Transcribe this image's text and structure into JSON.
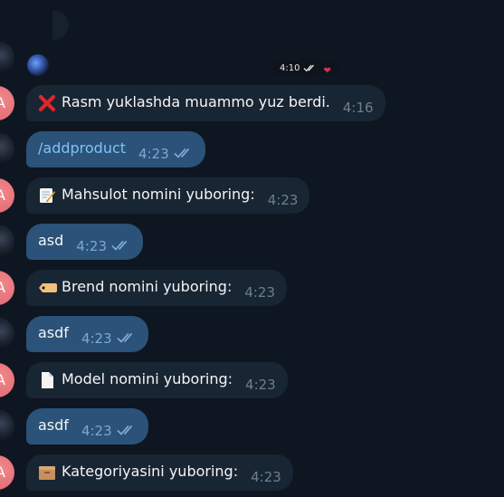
{
  "top": {
    "sticker_time": "4:10",
    "reaction_icon": "heart-icon"
  },
  "avatars": {
    "bot_letter": "A"
  },
  "messages": [
    {
      "side": "in",
      "emoji": "cross-mark-icon",
      "text": "Rasm yuklashda muammo yuz berdi.",
      "time": "4:16"
    },
    {
      "side": "out",
      "text": "/addproduct",
      "time": "4:23",
      "read": true
    },
    {
      "side": "in",
      "emoji": "memo-icon",
      "text": "Mahsulot nomini yuboring:",
      "time": "4:23"
    },
    {
      "side": "out",
      "text": "asd",
      "time": "4:23",
      "read": true
    },
    {
      "side": "in",
      "emoji": "label-tag-icon",
      "text": "Brend nomini yuboring:",
      "time": "4:23"
    },
    {
      "side": "out",
      "text": "asdf",
      "time": "4:23",
      "read": true
    },
    {
      "side": "in",
      "emoji": "page-icon",
      "text": "Model nomini yuboring:",
      "time": "4:23"
    },
    {
      "side": "out",
      "text": "asdf",
      "time": "4:23",
      "read": true
    },
    {
      "side": "in",
      "emoji": "file-box-icon",
      "text": "Kategoriyasini yuboring:",
      "time": "4:23"
    }
  ],
  "colors": {
    "background": "#0e1621",
    "incoming_bubble": "#182533",
    "outgoing_bubble": "#2b5278",
    "link": "#7fc2f5",
    "bot_avatar": "#e46d78"
  }
}
